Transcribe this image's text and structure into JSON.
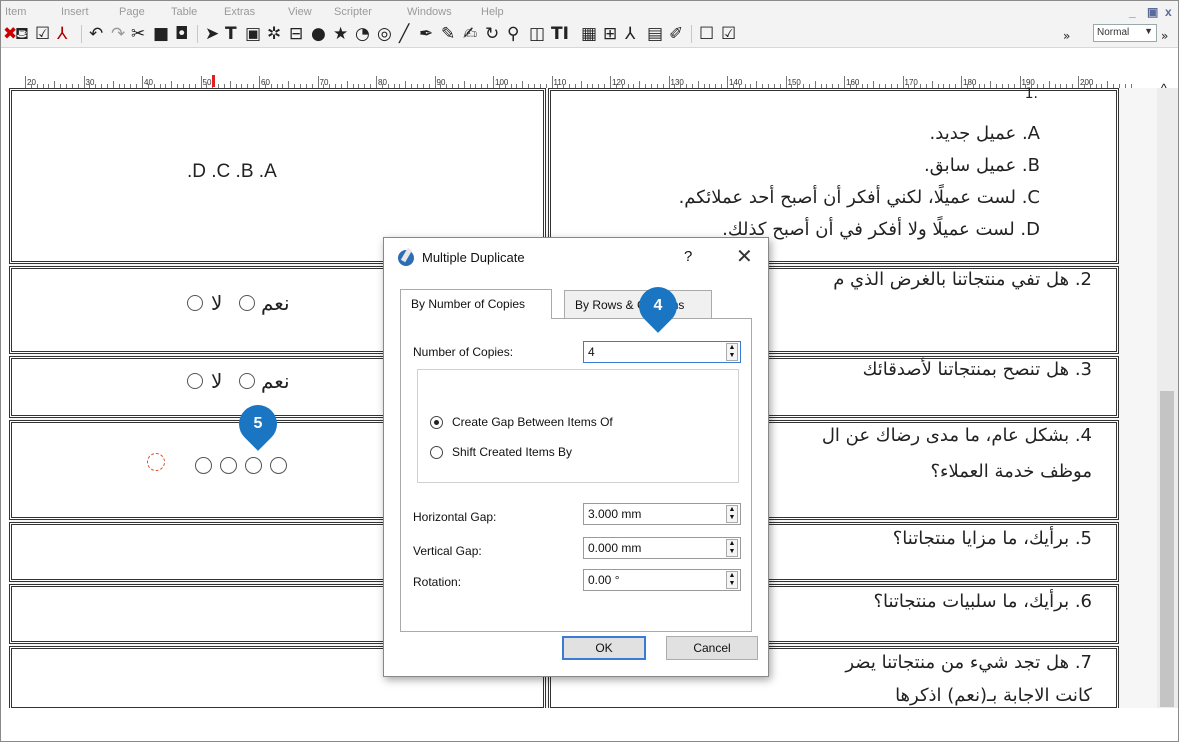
{
  "menu": [
    "Item",
    "Insert",
    "Page",
    "Table",
    "Extras",
    "View",
    "Scripter",
    "Windows",
    "Help"
  ],
  "window_controls": [
    "_",
    "ð",
    "x"
  ],
  "toolbar": {
    "style_select": "Normal",
    "overflow": "»",
    "icons": [
      "stamp-icon",
      "checkbox-icon",
      "pdf-icon",
      "undo-icon",
      "redo-icon",
      "cut-icon",
      "copy-icon",
      "paste-icon",
      "select-arrow-icon",
      "text-frame-icon",
      "image-frame-icon",
      "render-frame-icon",
      "table-icon",
      "shape-icon",
      "star-icon",
      "arc-icon",
      "spiral-icon",
      "line-icon",
      "bezier-icon",
      "freehand-icon",
      "calligraphic-icon",
      "rotate-icon",
      "zoom-icon",
      "edit-text-icon",
      "story-editor-icon",
      "link-frames-icon",
      "unlink-frames-icon",
      "measure-icon",
      "copy-properties-icon",
      "eyedropper-icon",
      "pdf-textfield-icon",
      "pdf-checkbox-icon"
    ]
  },
  "ruler": {
    "labels": [
      "20",
      "30",
      "40",
      "50",
      "60",
      "70",
      "80",
      "90",
      "100",
      "110",
      "120",
      "130",
      "140",
      "150",
      "160",
      "170",
      "180",
      "190",
      "200"
    ]
  },
  "document": {
    "q1_options": [
      "A. عميل جديد.",
      "B. عميل سابق.",
      "C. لست عميلًا، لكني أفكر أن أصبح أحد عملائكم.",
      "D. لست عميلًا ولا أفكر في أن أصبح كذلك."
    ],
    "q1_tail": ".1",
    "abcd": ".D    .C    .B    .A",
    "q2": "2. هل تفي منتجاتنا بالغرض الذي م",
    "q3": "3. هل تنصح بمنتجاتنا لأصدقائك",
    "q4_line1": "4. بشكل عام، ما مدى رضاك عن ال",
    "q4_line2": "موظف خدمة العملاء؟",
    "q5": "5. برأيك، ما مزايا منتجاتنا؟",
    "q6": "6. برأيك، ما سلبيات منتجاتنا؟",
    "q7_line1": "7. هل تجد شيء من منتجاتنا يضر",
    "q7_line2": "كانت الاجابة بـ(نعم) اذكرها",
    "yes": "نعم",
    "no": "لا"
  },
  "badges": {
    "step4": "4",
    "step5": "5"
  },
  "dialog": {
    "title": "Multiple Duplicate",
    "help": "?",
    "close": "✕",
    "tabs": [
      "By Number of Copies",
      "By Rows & Columns"
    ],
    "number_of_copies_label": "Number of Copies:",
    "number_of_copies_value": "4",
    "radio_gap": "Create Gap Between Items Of",
    "radio_shift": "Shift Created Items By",
    "horizontal_gap_label": "Horizontal Gap:",
    "horizontal_gap_value": "3.000 mm",
    "vertical_gap_label": "Vertical Gap:",
    "vertical_gap_value": "0.000 mm",
    "rotation_label": "Rotation:",
    "rotation_value": "0.00 °",
    "ok": "OK",
    "cancel": "Cancel"
  }
}
